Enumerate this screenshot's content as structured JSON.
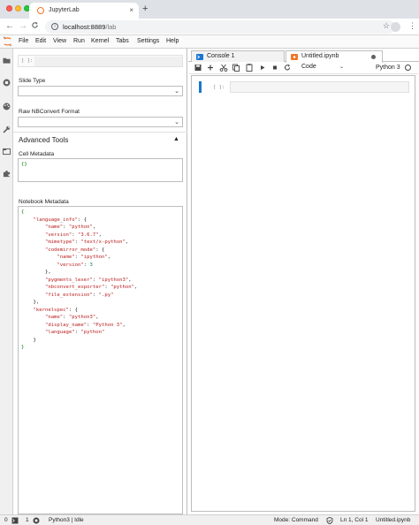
{
  "browser": {
    "tab_title": "JupyterLab",
    "tab_close": "×",
    "new_tab": "+",
    "back": "←",
    "forward": "→",
    "reload": "C",
    "url_host": "localhost:8889",
    "url_path": "/lab",
    "kebab": "⋮",
    "star": "☆"
  },
  "menu": {
    "items": [
      "File",
      "Edit",
      "View",
      "Run",
      "Kernel",
      "Tabs",
      "Settings",
      "Help"
    ]
  },
  "inspector": {
    "prompt": "[ ]:",
    "slide_type_label": "Slide Type",
    "raw_format_label": "Raw NBConvert Format",
    "advanced_tools_label": "Advanced Tools",
    "caret": "▲",
    "cell_metadata_label": "Cell Metadata",
    "cell_metadata_value": "{}",
    "notebook_metadata_label": "Notebook Metadata",
    "chevron": "⌄"
  },
  "notebook_metadata": {
    "l01": "{",
    "l02_key": "\"language_info\"",
    "l02_rest": ": {",
    "l03_key": "\"name\"",
    "l03_val": "\"python\"",
    "l04_key": "\"version\"",
    "l04_val": "\"3.6.7\"",
    "l05_key": "\"mimetype\"",
    "l05_val": "\"text/x-python\"",
    "l06_key": "\"codemirror_mode\"",
    "l06_rest": ": {",
    "l07_key": "\"name\"",
    "l07_val": "\"ipython\"",
    "l08_key": "\"version\"",
    "l08_val": "3",
    "l09": "},",
    "l10_key": "\"pygments_lexer\"",
    "l10_val": "\"ipython3\"",
    "l11_key": "\"nbconvert_exporter\"",
    "l11_val": "\"python\"",
    "l12_key": "\"file_extension\"",
    "l12_val": "\".py\"",
    "l13": "},",
    "l14_key": "\"kernelspec\"",
    "l14_rest": ": {",
    "l15_key": "\"name\"",
    "l15_val": "\"python3\"",
    "l16_key": "\"display_name\"",
    "l16_val": "\"Python 3\"",
    "l17_key": "\"language\"",
    "l17_val": "\"python\"",
    "l18": "}",
    "l19": "}"
  },
  "main": {
    "tabs": [
      {
        "label": "Console 1"
      },
      {
        "label": "Untitled.ipynb"
      }
    ],
    "cell_type": "Code",
    "kernel_name": "Python 3",
    "cell_prompt": "[ ]:"
  },
  "status": {
    "count_a": "0",
    "count_b": "1",
    "kernel": "Python3 | Idle",
    "mode": "Mode: Command",
    "position": "Ln 1, Col 1",
    "file": "Untitled.ipynb"
  },
  "colors": {
    "accent": "#1976d2",
    "jupyter_orange": "#f37626",
    "string": "#ba2121",
    "bracket": "#008000",
    "number": "#098658"
  }
}
